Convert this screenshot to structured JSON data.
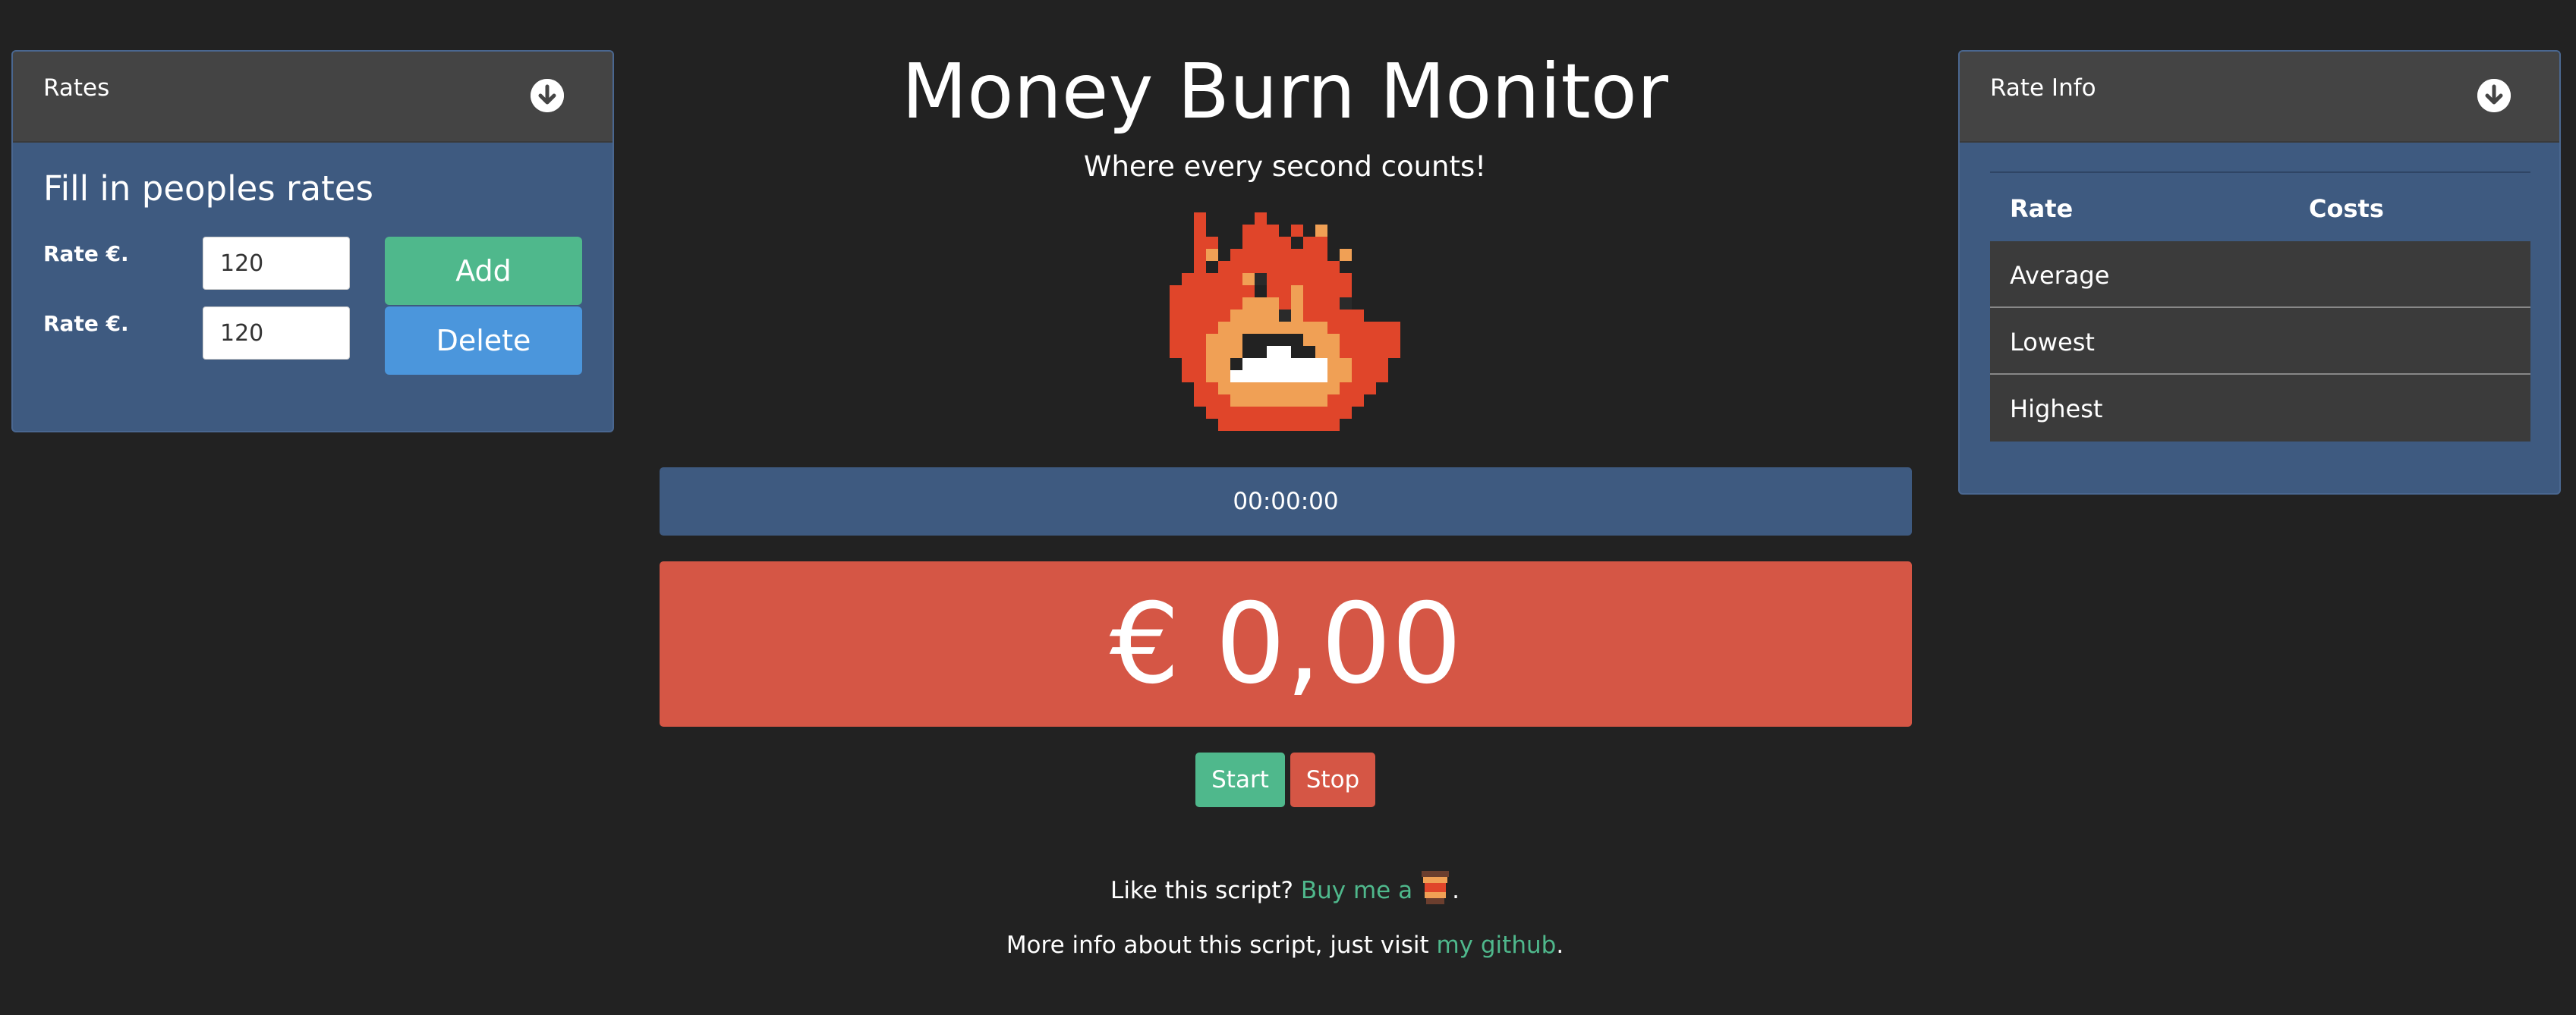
{
  "app": {
    "title": "Money Burn Monitor",
    "subtitle": "Where every second counts!"
  },
  "rates_panel": {
    "title": "Rates",
    "toggle_icon": "arrow-down-circle-icon",
    "heading": "Fill in peoples rates",
    "rows": [
      {
        "label": "Rate €.",
        "value": "120"
      },
      {
        "label": "Rate €.",
        "value": "120"
      }
    ],
    "add_label": "Add",
    "delete_label": "Delete"
  },
  "rate_info_panel": {
    "title": "Rate Info",
    "toggle_icon": "arrow-down-circle-icon",
    "columns": [
      "Rate",
      "Costs"
    ],
    "rows": [
      {
        "label": "Average",
        "cost": ""
      },
      {
        "label": "Lowest",
        "cost": ""
      },
      {
        "label": "Highest",
        "cost": ""
      }
    ]
  },
  "monitor": {
    "fire_icon": "pixel-fire-icon",
    "timer": "00:00:00",
    "cost": "€ 0,00",
    "start_label": "Start",
    "stop_label": "Stop"
  },
  "footer": {
    "line1_text": "Like this script?",
    "line1_link": "Buy me a",
    "line1_icon": "coffee-cup-icon",
    "line1_end": ".",
    "line2_text": "More info about this script, just visit",
    "line2_link": "my github",
    "line2_end": "."
  },
  "colors": {
    "background": "#222222",
    "panel": "#3e5a80",
    "green": "#4fb88c",
    "blue": "#4b96dc",
    "red": "#d55645"
  }
}
